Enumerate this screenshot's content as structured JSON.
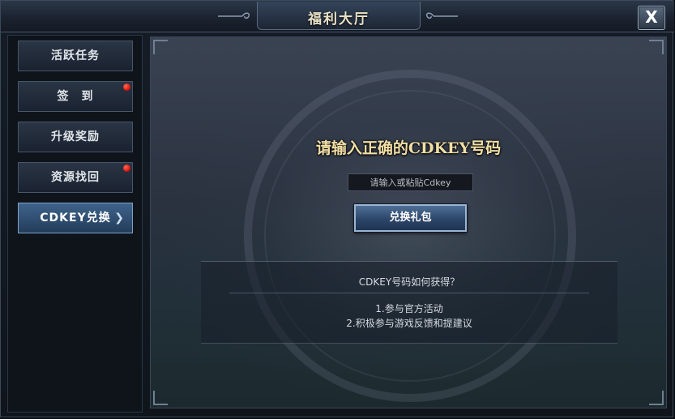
{
  "window": {
    "title": "福利大厅",
    "close_label": "X"
  },
  "sidebar": {
    "items": [
      {
        "label": "活跃任务",
        "active": false,
        "badge": false
      },
      {
        "label": "签　到",
        "active": false,
        "badge": true
      },
      {
        "label": "升级奖励",
        "active": false,
        "badge": false
      },
      {
        "label": "资源找回",
        "active": false,
        "badge": true
      },
      {
        "label": "CDKEY兑换",
        "active": true,
        "badge": false
      }
    ],
    "active_arrow": "❯"
  },
  "main": {
    "heading": "请输入正确的CDKEY号码",
    "input": {
      "value": "",
      "placeholder": "请输入或粘贴Cdkey"
    },
    "redeem_button": "兑换礼包",
    "info": {
      "title": "CDKEY号码如何获得？",
      "lines": [
        "1.参与官方活动",
        "2.积极参与游戏反馈和提建议"
      ]
    }
  },
  "colors": {
    "heading_gold": "#f2dfa6",
    "active_tab_blue": "#3f638b",
    "badge_red": "#e0190f"
  }
}
